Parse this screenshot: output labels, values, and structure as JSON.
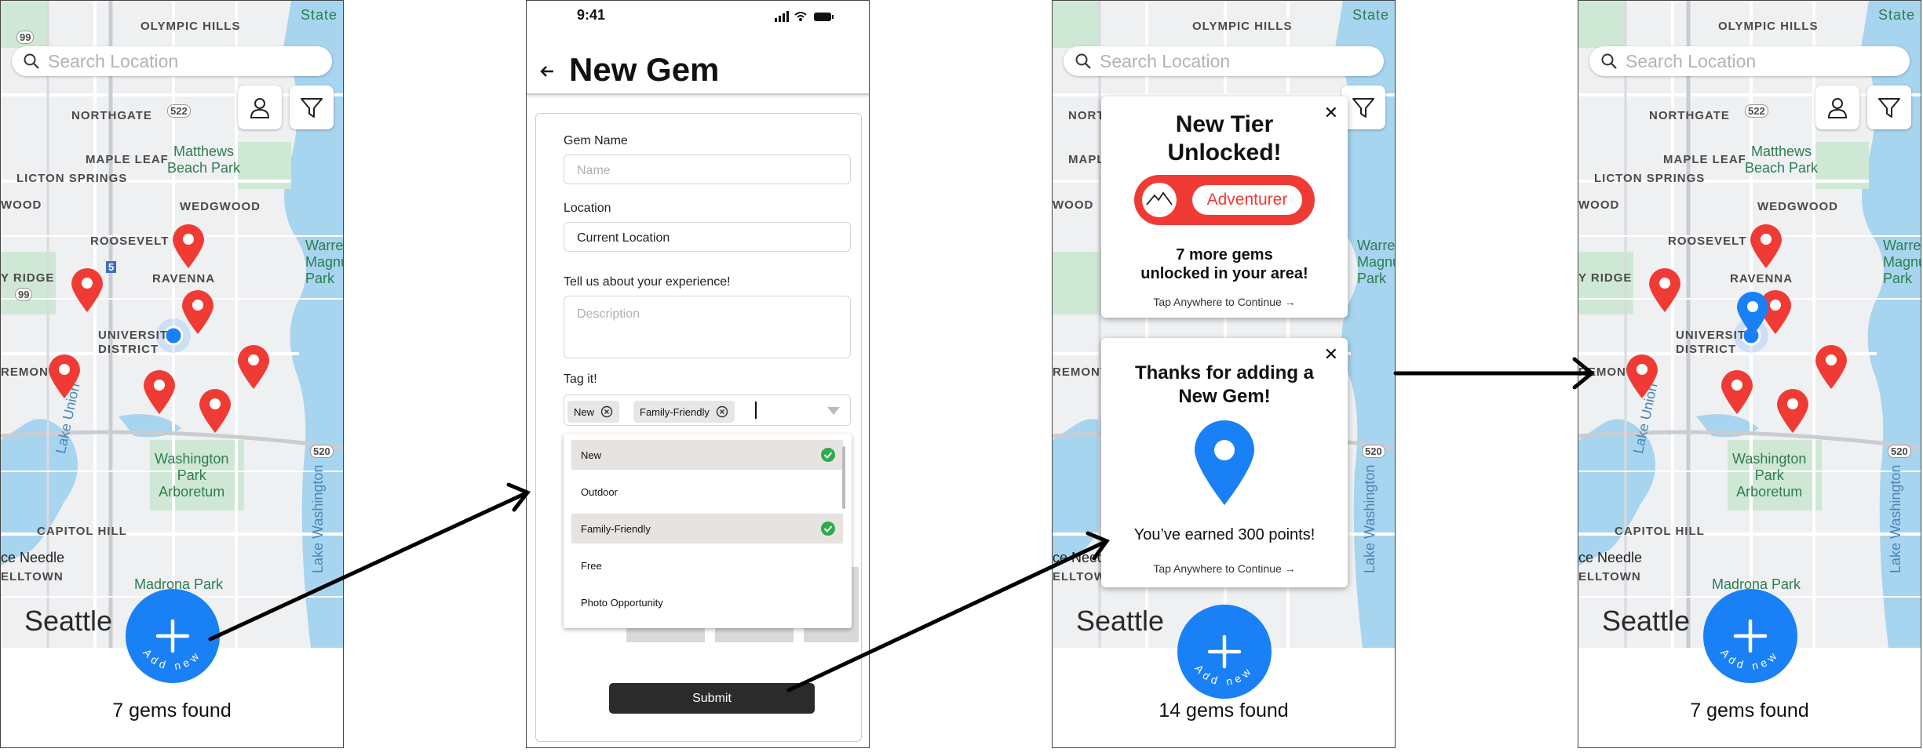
{
  "screen1": {
    "search_placeholder": "Search Location",
    "labels": {
      "olympic_hills": "OLYMPIC HILLS",
      "state": "State",
      "northgate": "NORTHGATE",
      "matthews": "Matthews\nBeach Park",
      "maple_leaf": "MAPLE LEAF",
      "licton": "LICTON SPRINGS",
      "wedgwood": "WEDGWOOD",
      "wood": "WOOD",
      "roosevelt": "ROOSEVELT",
      "ravenna": "RAVENNA",
      "warren": "Warren\nMagnu\nPark",
      "ridge": "Y RIDGE",
      "university": "UNIVERSIT\nDISTRICT",
      "fremont": "REMONT",
      "lake_union": "Lake Union",
      "washington_park": "Washington\nPark\nArboretum",
      "lake_washington": "Lake Washington",
      "capitol_hill": "CAPITOL HILL",
      "needle": "ce Needle",
      "belltown": "ELLTOWN",
      "madrona": "Madrona Park",
      "seattle": "Seattle",
      "r522": "522",
      "r520": "520",
      "r99": "99",
      "r5": "5"
    },
    "add_new": "Add new",
    "count": "7 gems found"
  },
  "screen2": {
    "time": "9:41",
    "title": "New Gem",
    "gem_name_label": "Gem Name",
    "gem_name_placeholder": "Name",
    "location_label": "Location",
    "location_value": "Current Location",
    "experience_label": "Tell us about your experience!",
    "description_placeholder": "Description",
    "tag_label": "Tag it!",
    "chips": [
      "New",
      "Family-Friendly"
    ],
    "options": [
      {
        "label": "New",
        "selected": true
      },
      {
        "label": "Outdoor",
        "selected": false
      },
      {
        "label": "Family-Friendly",
        "selected": true
      },
      {
        "label": "Free",
        "selected": false
      },
      {
        "label": "Photo Opportunity",
        "selected": false
      }
    ],
    "submit": "Submit"
  },
  "screen3": {
    "tier_title": "New Tier\nUnlocked!",
    "tier_name": "Adventurer",
    "tier_msg": "7 more gems\nunlocked in your area!",
    "tap_continue": "Tap Anywhere to Continue →",
    "thanks_title": "Thanks for adding a\nNew Gem!",
    "points_msg": "You’ve earned 300 points!",
    "count": "14 gems found"
  },
  "screen4": {
    "count": "7 gems found"
  },
  "colors": {
    "pin_red": "#f03b35",
    "pin_blue": "#1a80f5",
    "accent": "#1a80f5"
  }
}
